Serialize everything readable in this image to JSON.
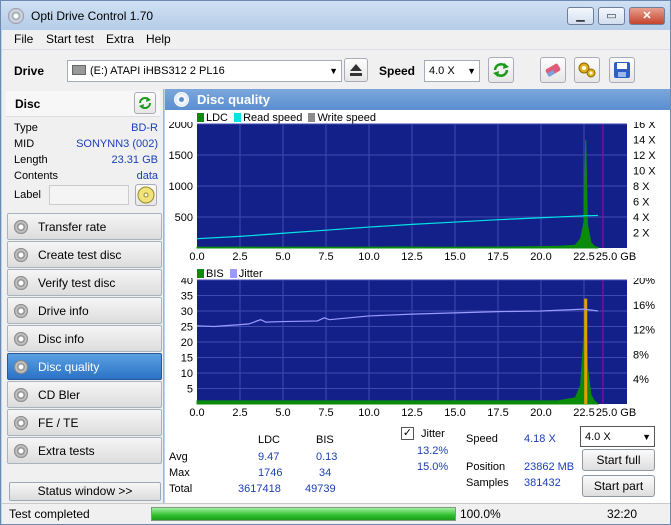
{
  "window": {
    "title": "Opti Drive Control 1.70",
    "controls": [
      "minimize-button",
      "maximize-button",
      "close-button"
    ]
  },
  "menu": {
    "items": [
      "File",
      "Start test",
      "Extra",
      "Help"
    ]
  },
  "drivebar": {
    "drive_label": "Drive",
    "drive_value": "(E:)   ATAPI iHBS312   2 PL16",
    "speed_label": "Speed",
    "speed_value": "4.0 X"
  },
  "disc": {
    "header": "Disc",
    "rows": [
      {
        "key": "Type",
        "value": "BD-R"
      },
      {
        "key": "MID",
        "value": "SONYNN3 (002)"
      },
      {
        "key": "Length",
        "value": "23.31 GB"
      },
      {
        "key": "Contents",
        "value": "data"
      }
    ],
    "label_key": "Label",
    "label_value": ""
  },
  "nav": {
    "items": [
      {
        "label": "Transfer rate",
        "active": false
      },
      {
        "label": "Create test disc",
        "active": false
      },
      {
        "label": "Verify test disc",
        "active": false
      },
      {
        "label": "Drive info",
        "active": false
      },
      {
        "label": "Disc info",
        "active": false
      },
      {
        "label": "Disc quality",
        "active": true
      },
      {
        "label": "CD Bler",
        "active": false
      },
      {
        "label": "FE / TE",
        "active": false
      },
      {
        "label": "Extra tests",
        "active": false
      }
    ],
    "status_window_button": "Status window >>"
  },
  "panel": {
    "title": "Disc quality"
  },
  "chart_data": [
    {
      "type": "line",
      "legend": [
        "LDC",
        "Read speed",
        "Write speed"
      ],
      "colors": {
        "LDC": "#0a8c0a",
        "Read speed": "#00e5e5",
        "Write speed": "#8c8c8c",
        "background": "#14208a",
        "grid": "#3f4ab0",
        "marker": "#b000b0"
      },
      "x_ticks": [
        "0.0",
        "2.5",
        "5.0",
        "7.5",
        "10.0",
        "12.5",
        "15.0",
        "17.5",
        "20.0",
        "22.5",
        "25.0 GB"
      ],
      "xlim": [
        0,
        25
      ],
      "y_left_ticks": [
        "2000",
        "1500",
        "1000",
        "500"
      ],
      "ylim_left": [
        0,
        2000
      ],
      "y_right_ticks": [
        "16 X",
        "14 X",
        "12 X",
        "10 X",
        "8 X",
        "6 X",
        "4 X",
        "2 X"
      ],
      "ylim_right": [
        0,
        16
      ],
      "data_end_x": 23.31,
      "marker_x": 23.6,
      "series": [
        {
          "name": "LDC",
          "x": [
            0,
            2,
            4,
            6,
            8,
            10,
            12,
            14,
            16,
            18,
            20,
            21,
            22,
            22.3,
            22.5,
            22.6,
            22.7,
            22.9,
            23.1,
            23.31
          ],
          "y": [
            12,
            14,
            13,
            15,
            12,
            14,
            16,
            13,
            15,
            16,
            22,
            28,
            45,
            150,
            420,
            1746,
            380,
            90,
            25,
            10
          ]
        },
        {
          "name": "Read speed",
          "x": [
            0,
            2.5,
            5,
            7.5,
            10,
            12.5,
            15,
            17.5,
            20,
            22.5,
            23.31
          ],
          "y": [
            1.2,
            1.5,
            1.9,
            2.3,
            2.7,
            3.05,
            3.35,
            3.65,
            3.9,
            4.15,
            4.2
          ]
        }
      ]
    },
    {
      "type": "line",
      "legend": [
        "BIS",
        "Jitter"
      ],
      "colors": {
        "BIS": "#0a8c0a",
        "Jitter": "#9a9aff",
        "spike": "#e5a000",
        "background": "#14208a",
        "grid": "#3f4ab0",
        "marker": "#b000b0"
      },
      "x_ticks": [
        "0.0",
        "2.5",
        "5.0",
        "7.5",
        "10.0",
        "12.5",
        "15.0",
        "17.5",
        "20.0",
        "22.5",
        "25.0 GB"
      ],
      "xlim": [
        0,
        25
      ],
      "y_left_ticks": [
        "40",
        "35",
        "30",
        "25",
        "20",
        "15",
        "10",
        "5"
      ],
      "ylim_left": [
        0,
        40
      ],
      "y_right_ticks": [
        "20%",
        "16%",
        "12%",
        "8%",
        "4%"
      ],
      "ylim_right": [
        0,
        20
      ],
      "data_end_x": 23.31,
      "marker_x": 23.6,
      "series": [
        {
          "name": "BIS",
          "x": [
            0,
            2,
            4,
            6,
            8,
            10,
            12,
            14,
            16,
            18,
            20,
            21,
            22,
            22.3,
            22.5,
            22.6,
            22.7,
            22.9,
            23.1,
            23.31
          ],
          "y": [
            1,
            1,
            1,
            1,
            1,
            1,
            1,
            1,
            1,
            1,
            1,
            1,
            2,
            6,
            22,
            34,
            12,
            3,
            1,
            0
          ]
        },
        {
          "name": "Jitter",
          "x": [
            0,
            1,
            2,
            3,
            3.7,
            4.0,
            5,
            7,
            7.4,
            7.7,
            10,
            12.5,
            15,
            17.5,
            20,
            22.5,
            23.31
          ],
          "y": [
            12.6,
            12.5,
            12.7,
            12.9,
            13.6,
            13.2,
            13.3,
            13.4,
            13.9,
            13.6,
            14.2,
            14.5,
            14.7,
            14.9,
            15.0,
            15.3,
            15.0
          ]
        }
      ]
    }
  ],
  "stats": {
    "col_ldc": "LDC",
    "col_bis": "BIS",
    "jitter_label": "Jitter",
    "jitter_checked": true,
    "rows": [
      {
        "label": "Avg",
        "ldc": "9.47",
        "bis": "0.13",
        "jitter": "13.2%"
      },
      {
        "label": "Max",
        "ldc": "1746",
        "bis": "34",
        "jitter": "15.0%"
      },
      {
        "label": "Total",
        "ldc": "3617418",
        "bis": "49739",
        "jitter": ""
      }
    ],
    "speed_label": "Speed",
    "speed_value": "4.18 X",
    "position_label": "Position",
    "position_value": "23862 MB",
    "samples_label": "Samples",
    "samples_value": "381432",
    "speed_select": "4.0 X",
    "start_full": "Start full",
    "start_part": "Start part"
  },
  "status": {
    "text": "Test completed",
    "progress_percent": 100,
    "progress_text": "100.0%",
    "time": "32:20"
  }
}
